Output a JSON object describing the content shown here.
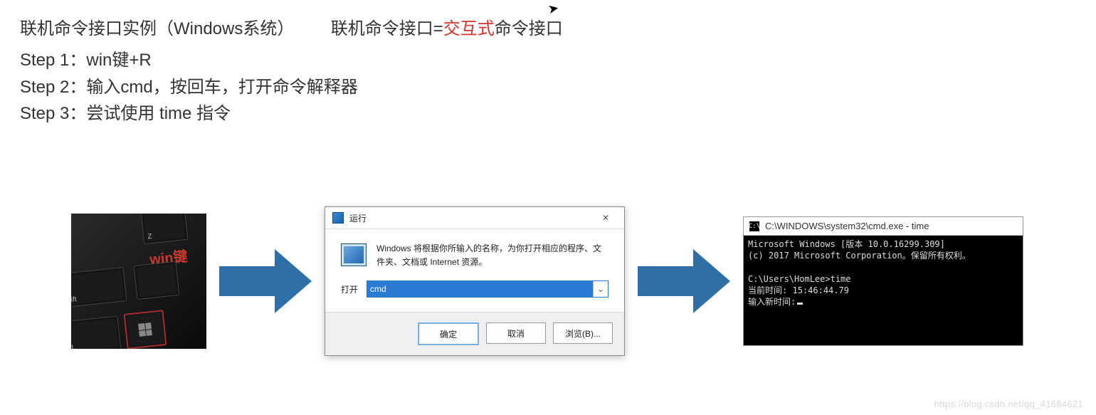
{
  "header": {
    "title_part1": "联机命令接口实例（Windows系统）",
    "title_part2a": "联机命令接口=",
    "title_red": "交互式",
    "title_part2b": "命令接口",
    "steps": [
      "Step 1：win键+R",
      "Step 2：输入cmd，按回车，打开命令解释器",
      "Step 3：尝试使用 time 指令"
    ]
  },
  "keyboard": {
    "label": "win键",
    "keys": {
      "z": "Z",
      "shift": "Shift",
      "ctrl": "Ctrl"
    }
  },
  "run_dialog": {
    "title": "运行",
    "close_glyph": "✕",
    "description": "Windows 将根据你所输入的名称，为你打开相应的程序、文件夹、文档或 Internet 资源。",
    "open_label": "打开",
    "input_value": "cmd",
    "dropdown_glyph": "⌄",
    "buttons": {
      "ok": "确定",
      "cancel": "取消",
      "browse": "浏览(B)..."
    }
  },
  "cmd": {
    "title": "C:\\WINDOWS\\system32\\cmd.exe - time",
    "title_icon_text": "C:\\",
    "line1": "Microsoft Windows [版本 10.0.16299.309]",
    "line2": "(c) 2017 Microsoft Corporation。保留所有权利。",
    "prompt": "C:\\Users\\HomLee>time",
    "current_time_label": "当前时间:",
    "current_time_value": "15:46:44.79",
    "new_time_label": "输入新时间:"
  },
  "watermark": "https://blog.csdn.net/qq_41684621"
}
